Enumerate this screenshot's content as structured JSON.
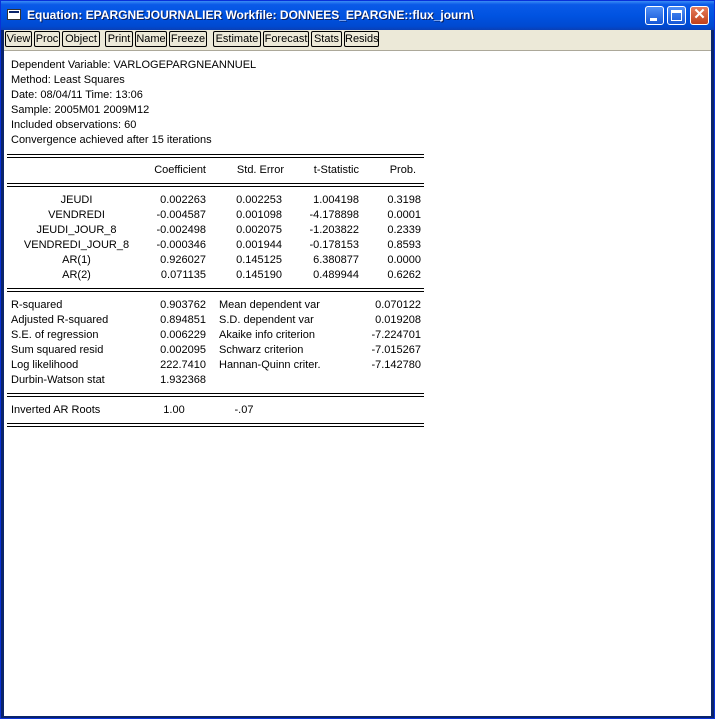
{
  "window": {
    "title": "Equation: EPARGNEJOURNALIER   Workfile: DONNEES_EPARGNE::flux_journ\\"
  },
  "toolbar": [
    "View",
    "Proc",
    "Object",
    "Print",
    "Name",
    "Freeze",
    "Estimate",
    "Forecast",
    "Stats",
    "Resids"
  ],
  "header": [
    "Dependent Variable: VARLOGEPARGNEANNUEL",
    "Method: Least Squares",
    "Date: 08/04/11   Time: 13:06",
    "Sample: 2005M01 2009M12",
    "Included observations: 60",
    "Convergence achieved after 15 iterations"
  ],
  "columns": [
    "Coefficient",
    "Std. Error",
    "t-Statistic",
    "Prob."
  ],
  "coefficients": [
    {
      "var": "JEUDI",
      "coef": "0.002263",
      "se": "0.002253",
      "t": "1.004198",
      "p": "0.3198"
    },
    {
      "var": "VENDREDI",
      "coef": "-0.004587",
      "se": "0.001098",
      "t": "-4.178898",
      "p": "0.0001"
    },
    {
      "var": "JEUDI_JOUR_8",
      "coef": "-0.002498",
      "se": "0.002075",
      "t": "-1.203822",
      "p": "0.2339"
    },
    {
      "var": "VENDREDI_JOUR_8",
      "coef": "-0.000346",
      "se": "0.001944",
      "t": "-0.178153",
      "p": "0.8593"
    },
    {
      "var": "AR(1)",
      "coef": "0.926027",
      "se": "0.145125",
      "t": "6.380877",
      "p": "0.0000"
    },
    {
      "var": "AR(2)",
      "coef": "0.071135",
      "se": "0.145190",
      "t": "0.489944",
      "p": "0.6262"
    }
  ],
  "stats": [
    {
      "l": "R-squared",
      "lv": "0.903762",
      "r": "Mean dependent var",
      "rv": "0.070122"
    },
    {
      "l": "Adjusted R-squared",
      "lv": "0.894851",
      "r": "S.D. dependent var",
      "rv": "0.019208"
    },
    {
      "l": "S.E. of regression",
      "lv": "0.006229",
      "r": "Akaike info criterion",
      "rv": "-7.224701"
    },
    {
      "l": "Sum squared resid",
      "lv": "0.002095",
      "r": "Schwarz criterion",
      "rv": "-7.015267"
    },
    {
      "l": "Log likelihood",
      "lv": "222.7410",
      "r": "Hannan-Quinn criter.",
      "rv": "-7.142780"
    },
    {
      "l": "Durbin-Watson stat",
      "lv": "1.932368",
      "r": "",
      "rv": ""
    }
  ],
  "roots": {
    "label": "Inverted AR Roots",
    "v1": "1.00",
    "v2": "-.07"
  }
}
